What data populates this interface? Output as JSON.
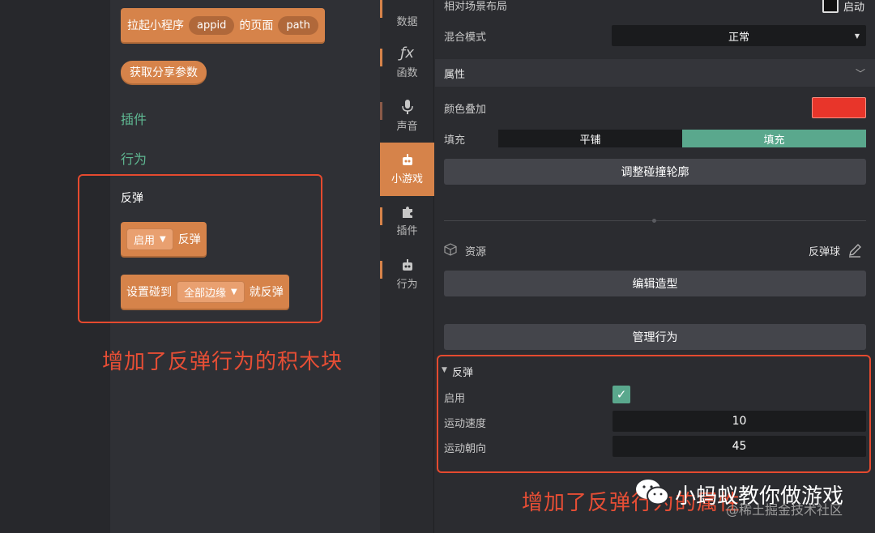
{
  "blocks": {
    "launch_prefix": "拉起小程序",
    "launch_appid": "appid",
    "launch_mid": "的页面",
    "launch_path": "path",
    "get_share": "获取分享参数",
    "plugins_label": "插件",
    "behavior_label": "行为",
    "bounce_title": "反弹",
    "enable_dd": "启用",
    "enable_suffix": "反弹",
    "set_prefix": "设置碰到",
    "edges_dd": "全部边缘",
    "set_suffix": "就反弹"
  },
  "annotations": {
    "left": "增加了反弹行为的积木块",
    "right": "增加了反弹行为的属性"
  },
  "tabs": [
    {
      "label": "数据",
      "icon": "≡"
    },
    {
      "label": "函数",
      "icon": "ƒx"
    },
    {
      "label": "声音",
      "icon": "🎙"
    },
    {
      "label": "小游戏",
      "icon": "⚙"
    },
    {
      "label": "插件",
      "icon": "✚"
    },
    {
      "label": "行为",
      "icon": "⚙"
    }
  ],
  "props": {
    "relative_layout_label": "相对场景布局",
    "relative_layout_value": "启动",
    "blend_label": "混合模式",
    "blend_value": "正常",
    "attributes_title": "属性",
    "color_overlay_label": "颜色叠加",
    "color_overlay_value": "#e8352a",
    "fill_label": "填充",
    "fill_tile": "平铺",
    "fill_fill": "填充",
    "collision_button": "调整碰撞轮廓",
    "resource_label": "资源",
    "resource_value": "反弹球",
    "edit_shape_button": "编辑造型",
    "manage_behavior_button": "管理行为",
    "bounce_section": "反弹",
    "enable_label": "启用",
    "speed_label": "运动速度",
    "speed_value": "10",
    "direction_label": "运动朝向",
    "direction_value": "45"
  },
  "watermark": {
    "wechat": "小蚂蚁教你做游戏",
    "juejin": "@稀土掘金技术社区"
  },
  "colors": {
    "accent": "#d6834a",
    "green": "#5aa88d",
    "frame_red": "#e54a2f",
    "overlay_red": "#e8352a"
  }
}
